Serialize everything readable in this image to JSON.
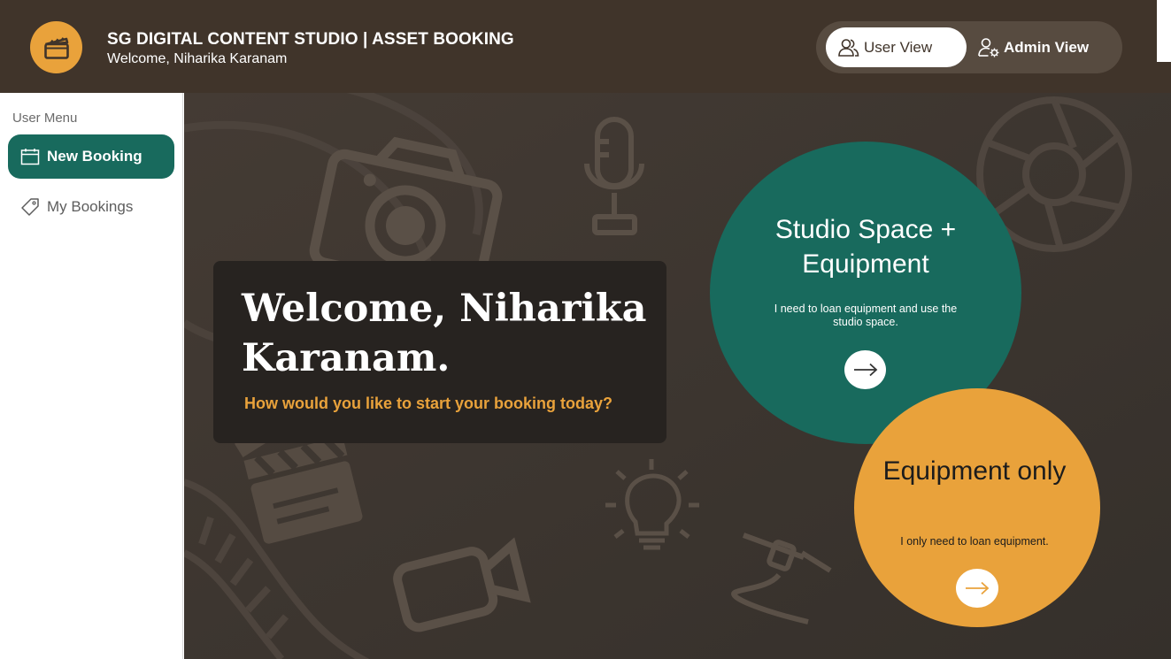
{
  "header": {
    "title": "SG DIGITAL CONTENT STUDIO | ASSET BOOKING",
    "subtitle": "Welcome, Niharika Karanam",
    "logo_icon": "clapperboard-icon",
    "views": {
      "user_label": "User View",
      "admin_label": "Admin View",
      "active": "User View"
    }
  },
  "sidebar": {
    "menu_label": "User Menu",
    "items": [
      {
        "label": "New Booking",
        "icon": "calendar-icon",
        "active": true
      },
      {
        "label": "My Bookings",
        "icon": "tag-icon",
        "active": false
      }
    ]
  },
  "hero": {
    "welcome_title": "Welcome, Niharika Karanam.",
    "welcome_subtitle": "How would you like to start your booking today?",
    "options": [
      {
        "title": "Studio Space + Equipment",
        "description": "I need to loan equipment and use the studio space."
      },
      {
        "title": "Equipment only",
        "description": "I only need to loan equipment."
      }
    ]
  },
  "colors": {
    "header_bg": "#40342a",
    "accent_teal": "#186a5d",
    "accent_orange": "#e9a23b",
    "hero_bg": "#3d3630",
    "card_bg": "#272320"
  }
}
